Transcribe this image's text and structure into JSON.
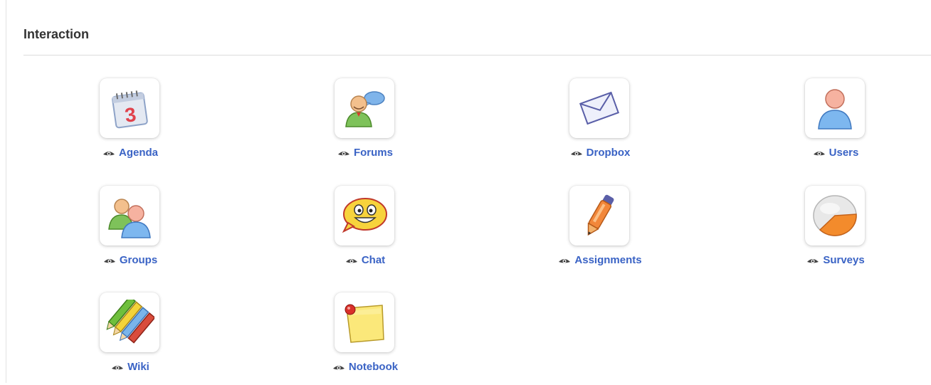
{
  "section": {
    "title": "Interaction"
  },
  "tools": [
    {
      "label": "Agenda",
      "icon": "calendar-icon"
    },
    {
      "label": "Forums",
      "icon": "forum-user-speech-icon"
    },
    {
      "label": "Dropbox",
      "icon": "envelope-icon"
    },
    {
      "label": "Users",
      "icon": "user-icon"
    },
    {
      "label": "Groups",
      "icon": "group-users-icon"
    },
    {
      "label": "Chat",
      "icon": "smiley-speech-bubble-icon"
    },
    {
      "label": "Assignments",
      "icon": "pen-icon"
    },
    {
      "label": "Surveys",
      "icon": "pie-chart-icon"
    },
    {
      "label": "Wiki",
      "icon": "pencils-icon"
    },
    {
      "label": "Notebook",
      "icon": "sticky-note-icon"
    }
  ],
  "colors": {
    "link": "#3a63c5",
    "title": "#333333",
    "divider": "#dcdcdc"
  }
}
